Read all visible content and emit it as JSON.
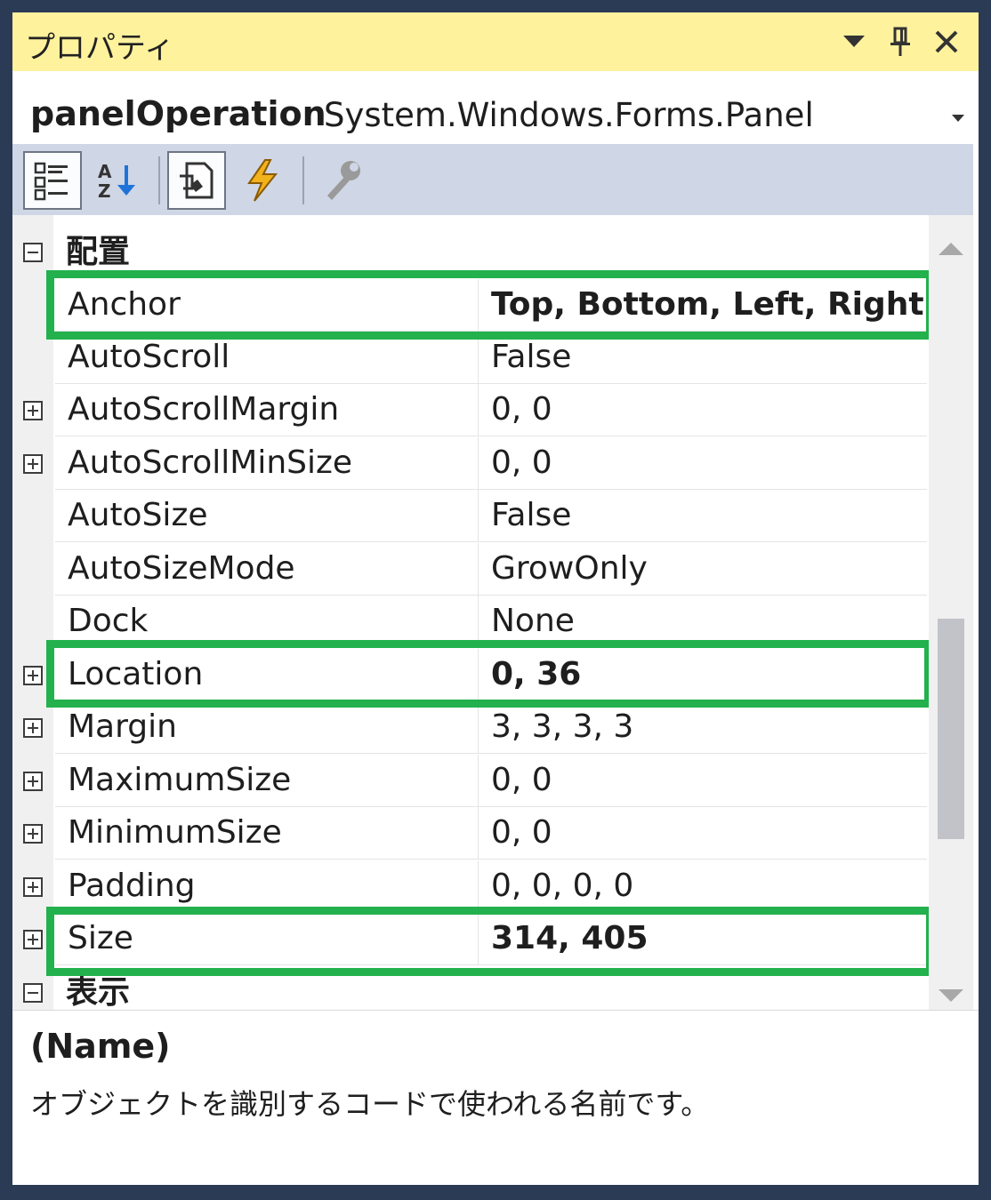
{
  "window": {
    "title": "プロパティ"
  },
  "object": {
    "name": "panelOperation",
    "type": "System.Windows.Forms.Panel"
  },
  "toolbar": {
    "buttons": [
      "categorized-icon",
      "alphabetical-icon",
      "properties-icon",
      "events-icon",
      "property-pages-icon"
    ]
  },
  "grid": {
    "categories": [
      {
        "label": "配置"
      },
      {
        "label": "表示"
      }
    ],
    "rows": [
      {
        "name": "Anchor",
        "value": "Top, Bottom, Left, Right",
        "expandable": false,
        "bold": true,
        "highlighted": true
      },
      {
        "name": "AutoScroll",
        "value": "False",
        "expandable": false,
        "bold": false,
        "highlighted": false
      },
      {
        "name": "AutoScrollMargin",
        "value": "0, 0",
        "expandable": true,
        "bold": false,
        "highlighted": false
      },
      {
        "name": "AutoScrollMinSize",
        "value": "0, 0",
        "expandable": true,
        "bold": false,
        "highlighted": false
      },
      {
        "name": "AutoSize",
        "value": "False",
        "expandable": false,
        "bold": false,
        "highlighted": false
      },
      {
        "name": "AutoSizeMode",
        "value": "GrowOnly",
        "expandable": false,
        "bold": false,
        "highlighted": false
      },
      {
        "name": "Dock",
        "value": "None",
        "expandable": false,
        "bold": false,
        "highlighted": false
      },
      {
        "name": "Location",
        "value": "0, 36",
        "expandable": true,
        "bold": true,
        "highlighted": true
      },
      {
        "name": "Margin",
        "value": "3, 3, 3, 3",
        "expandable": true,
        "bold": false,
        "highlighted": false
      },
      {
        "name": "MaximumSize",
        "value": "0, 0",
        "expandable": true,
        "bold": false,
        "highlighted": false
      },
      {
        "name": "MinimumSize",
        "value": "0, 0",
        "expandable": true,
        "bold": false,
        "highlighted": false
      },
      {
        "name": "Padding",
        "value": "0, 0, 0, 0",
        "expandable": true,
        "bold": false,
        "highlighted": false
      },
      {
        "name": "Size",
        "value": "314, 405",
        "expandable": true,
        "bold": true,
        "highlighted": true
      }
    ]
  },
  "description": {
    "title": "(Name)",
    "text": "オブジェクトを識別するコードで使われる名前です。"
  },
  "colors": {
    "titlebar": "#fff29d",
    "toolbar": "#cfd6e5",
    "highlight": "#22b14c",
    "frame": "#2b3a55"
  }
}
